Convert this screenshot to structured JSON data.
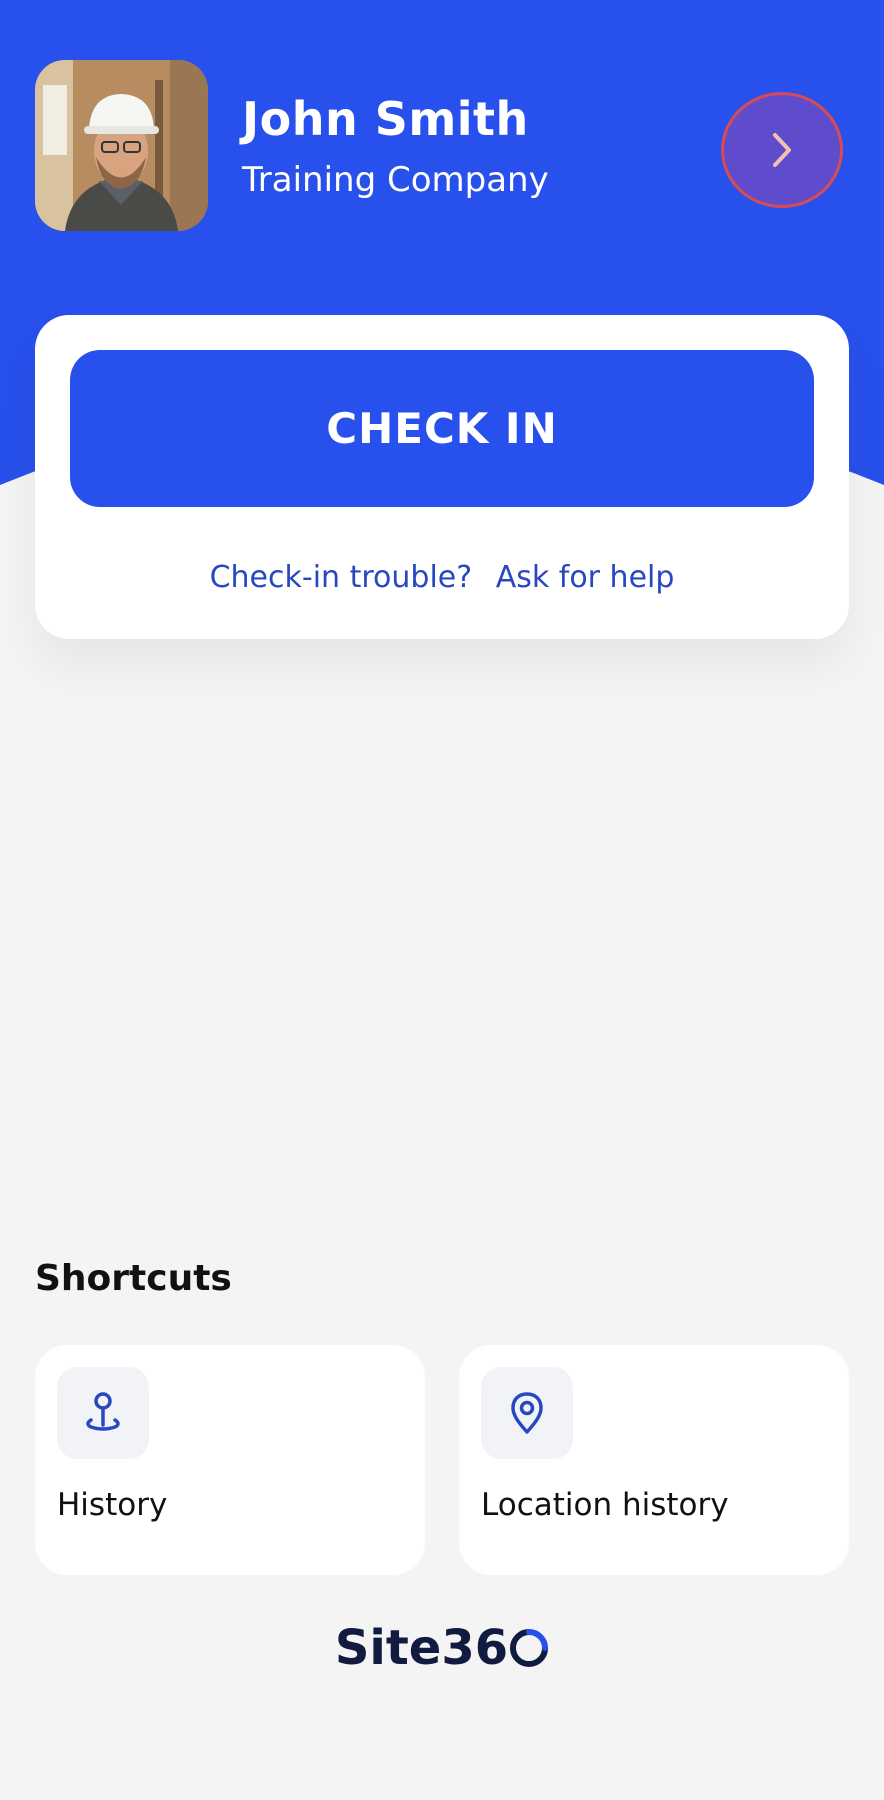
{
  "header": {
    "user_name": "John Smith",
    "company": "Training Company",
    "profile_icon": "chevron-right-icon",
    "avatar_description": "user photo"
  },
  "checkin": {
    "button_label": "CHECK IN",
    "trouble_text": "Check-in trouble?",
    "help_link": "Ask for help"
  },
  "shortcuts": {
    "title": "Shortcuts",
    "items": [
      {
        "label": "History",
        "icon": "history-pin-icon"
      },
      {
        "label": "Location history",
        "icon": "location-pin-icon"
      }
    ]
  },
  "brand": {
    "logo_text": "Site36"
  },
  "colors": {
    "primary_blue": "#2850ec",
    "page_bg": "#f4f4f5",
    "card_bg": "#ffffff",
    "link_blue": "#2848c0",
    "profile_button_bg": "#5f4ccc",
    "profile_button_border": "#d84b55",
    "brand_navy": "#101b3f"
  }
}
